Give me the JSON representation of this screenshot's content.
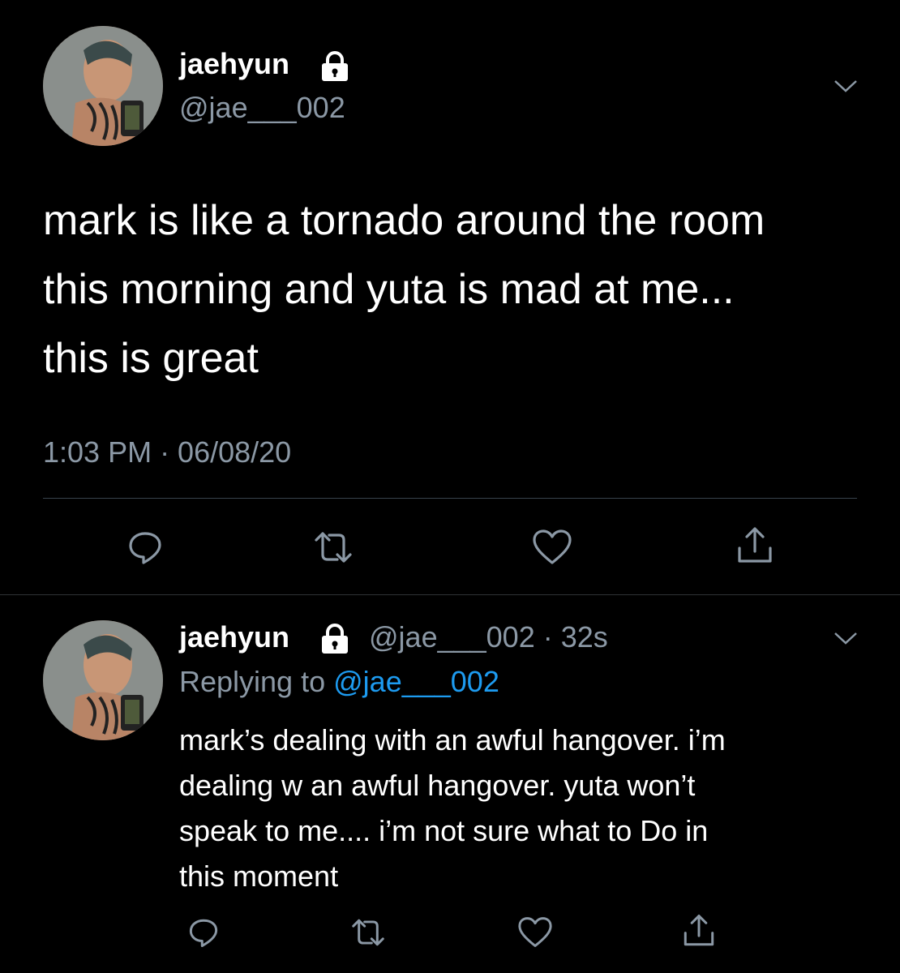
{
  "main_tweet": {
    "display_name": "jaehyun",
    "handle": "@jae___002",
    "text_lines": [
      "mark is like a tornado around the room",
      "this morning and yuta is mad at me...",
      "this is great"
    ],
    "timestamp": "1:03 PM · 06/08/20",
    "actions": [
      "reply-icon",
      "retweet-icon",
      "like-icon",
      "share-icon"
    ]
  },
  "reply_tweet": {
    "display_name": "jaehyun",
    "handle_time": "@jae___002 · 32s",
    "replying_prefix": "Replying to",
    "replying_handle": "@jae___002",
    "text_lines": [
      "mark’s dealing with an awful hangover. i’m",
      "dealing w an awful hangover. yuta won’t",
      "speak to me.... i’m not sure what to Do in",
      "this moment"
    ],
    "actions": [
      "reply-icon",
      "retweet-icon",
      "like-icon",
      "share-icon"
    ]
  },
  "colors": {
    "background": "#000000",
    "text": "#ffffff",
    "secondary": "#8b98a5",
    "link": "#1d9bf0",
    "divider": "#2f3336"
  }
}
